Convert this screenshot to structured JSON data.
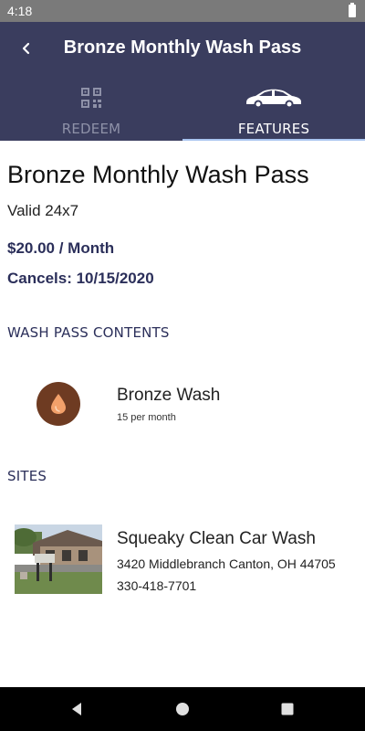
{
  "status_bar": {
    "time": "4:18"
  },
  "header": {
    "title": "Bronze Monthly Wash Pass"
  },
  "tabs": [
    {
      "label": "REDEEM",
      "icon": "qr-code-icon",
      "active": false
    },
    {
      "label": "FEATURES",
      "icon": "car-icon",
      "active": true
    }
  ],
  "pass": {
    "title": "Bronze Monthly Wash Pass",
    "validity": "Valid 24x7",
    "price": "$20.00 / Month",
    "cancels": "Cancels: 10/15/2020"
  },
  "contents": {
    "heading": "WASH PASS CONTENTS",
    "items": [
      {
        "name": "Bronze Wash",
        "quantity": "15 per month",
        "icon": "water-drop-icon",
        "icon_color": "#6e3b22"
      }
    ]
  },
  "sites": {
    "heading": "SITES",
    "items": [
      {
        "name": "Squeaky Clean Car Wash",
        "address": "3420 Middlebranch Canton, OH 44705",
        "phone": "330-418-7701"
      }
    ]
  },
  "colors": {
    "header_bg": "#3a3d5e",
    "accent_text": "#2b2f5a",
    "tab_indicator": "#a9c4f0"
  }
}
